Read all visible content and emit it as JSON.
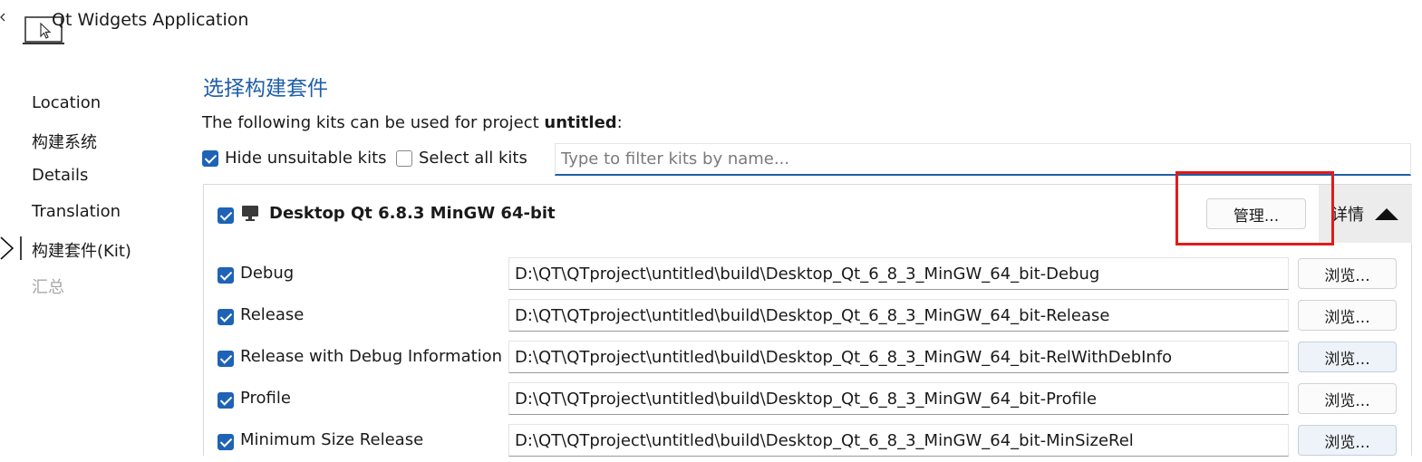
{
  "window": {
    "title": "Qt Widgets Application"
  },
  "sidebar": {
    "items": [
      {
        "label": "Location"
      },
      {
        "label": "构建系统"
      },
      {
        "label": "Details"
      },
      {
        "label": "Translation"
      },
      {
        "label": "构建套件(Kit)"
      },
      {
        "label": "汇总"
      }
    ],
    "current_index": 4
  },
  "main": {
    "title": "选择构建套件",
    "description_prefix": "The following kits can be used for project ",
    "project_name": "untitled",
    "description_suffix": ":",
    "hide_unsuitable": {
      "label": "Hide unsuitable kits",
      "checked": true
    },
    "select_all": {
      "label": "Select all kits",
      "checked": false
    },
    "filter": {
      "placeholder": "Type to filter kits by name...",
      "value": ""
    }
  },
  "kit": {
    "name": "Desktop Qt 6.8.3 MinGW 64-bit",
    "checked": true,
    "manage_label": "管理...",
    "details_label": "详情",
    "configurations": [
      {
        "name": "Debug",
        "checked": true,
        "path": "D:\\QT\\QTproject\\untitled\\build\\Desktop_Qt_6_8_3_MinGW_64_bit-Debug",
        "browse_label": "浏览..."
      },
      {
        "name": "Release",
        "checked": true,
        "path": "D:\\QT\\QTproject\\untitled\\build\\Desktop_Qt_6_8_3_MinGW_64_bit-Release",
        "browse_label": "浏览..."
      },
      {
        "name": "Release with Debug Information",
        "checked": true,
        "path": "D:\\QT\\QTproject\\untitled\\build\\Desktop_Qt_6_8_3_MinGW_64_bit-RelWithDebInfo",
        "browse_label": "浏览..."
      },
      {
        "name": "Profile",
        "checked": true,
        "path": "D:\\QT\\QTproject\\untitled\\build\\Desktop_Qt_6_8_3_MinGW_64_bit-Profile",
        "browse_label": "浏览..."
      },
      {
        "name": "Minimum Size Release",
        "checked": true,
        "path": "D:\\QT\\QTproject\\untitled\\build\\Desktop_Qt_6_8_3_MinGW_64_bit-MinSizeRel",
        "browse_label": "浏览..."
      }
    ]
  },
  "colors": {
    "accent": "#1f5fa8",
    "checkbox": "#1e63b6",
    "highlight": "#e11b1b",
    "disabled_text": "#a8a8a8"
  }
}
